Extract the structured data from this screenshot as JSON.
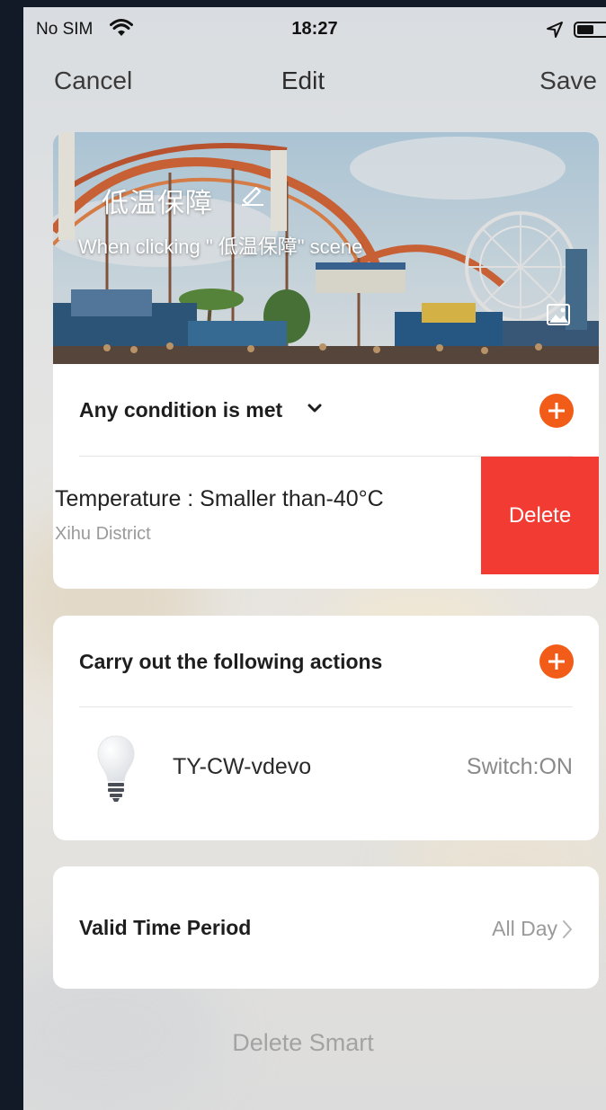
{
  "status_bar": {
    "carrier": "No SIM",
    "time": "18:27",
    "icons": [
      "wifi-icon",
      "location-arrow-icon",
      "battery-icon"
    ]
  },
  "nav": {
    "cancel": "Cancel",
    "title": "Edit",
    "save": "Save"
  },
  "scene": {
    "name": "低温保障",
    "description": "When clicking \" 低温保障\" scene",
    "icons": [
      "edit-pencil-icon",
      "change-image-icon"
    ]
  },
  "conditions": {
    "title": "Any condition is met",
    "items": [
      {
        "label": "Temperature : Smaller than-40°C",
        "location": "Xihu District",
        "swipe_action": "Delete"
      }
    ]
  },
  "actions": {
    "title": "Carry out the following actions",
    "items": [
      {
        "device": "TY-CW-vdevo",
        "state": "Switch:ON",
        "icon": "light-bulb-icon"
      }
    ]
  },
  "valid_time": {
    "label": "Valid Time Period",
    "value": "All Day"
  },
  "footer": {
    "delete_smart": "Delete Smart"
  },
  "colors": {
    "accent": "#f25c19",
    "delete": "#f23b32"
  }
}
